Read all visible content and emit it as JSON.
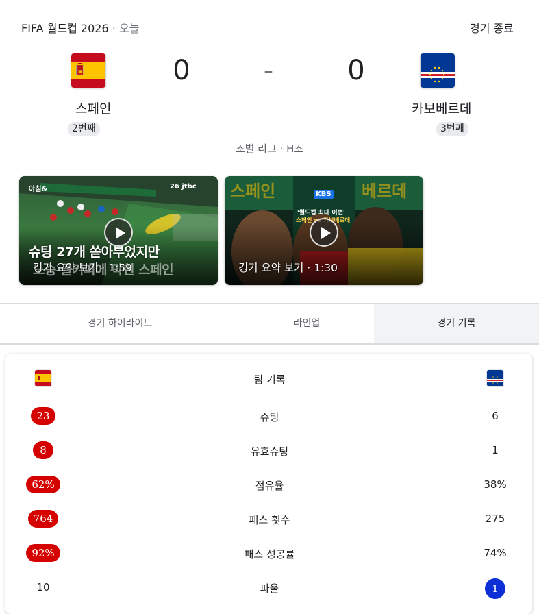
{
  "header": {
    "tournament": "FIFA 월드컵 2026",
    "separator": "·",
    "date": "오늘",
    "status": "경기 종료"
  },
  "match": {
    "home": {
      "name": "스페인",
      "score": "0",
      "rank": "2번째",
      "flag": "spain-flag"
    },
    "away": {
      "name": "카보베르데",
      "score": "0",
      "rank": "3번째",
      "flag": "cape-verde-flag"
    },
    "score_separator": "-",
    "round": "조별 리그 · H조"
  },
  "videos": [
    {
      "overlay_line1": "슈팅 27개 쏟아부었지만",
      "overlay_line2": "노승 골키퍼에 막힌 스페인",
      "label": "경기 요약 보기 · 1:59",
      "brand": "아침&",
      "channel": "26 jtbc"
    },
    {
      "banner_left": "스페인",
      "banner_right": "베르데",
      "badge": "KBS",
      "title": "'월드컵 최대 이변'",
      "subtitle": "스페인 vs 카보베르데",
      "label": "경기 요약 보기 · 1:30"
    }
  ],
  "tabs": [
    {
      "label": "경기 하이라이트",
      "active": false
    },
    {
      "label": "라인업",
      "active": false
    },
    {
      "label": "경기 기록",
      "active": true
    }
  ],
  "stats": {
    "header": "팀 기록",
    "rows": [
      {
        "label": "슈팅",
        "home": "23",
        "away": "6",
        "highlight": "home"
      },
      {
        "label": "유효슈팅",
        "home": "8",
        "away": "1",
        "highlight": "home"
      },
      {
        "label": "점유율",
        "home": "62%",
        "away": "38%",
        "highlight": "home"
      },
      {
        "label": "패스 횟수",
        "home": "764",
        "away": "275",
        "highlight": "home"
      },
      {
        "label": "패스 성공률",
        "home": "92%",
        "away": "74%",
        "highlight": "home"
      },
      {
        "label": "파울",
        "home": "10",
        "away": "1",
        "highlight": "away"
      }
    ]
  },
  "colors": {
    "highlight_home": "#d50000",
    "highlight_away": "#0d2fd6",
    "active_tab_bg": "#f1f3f4"
  }
}
